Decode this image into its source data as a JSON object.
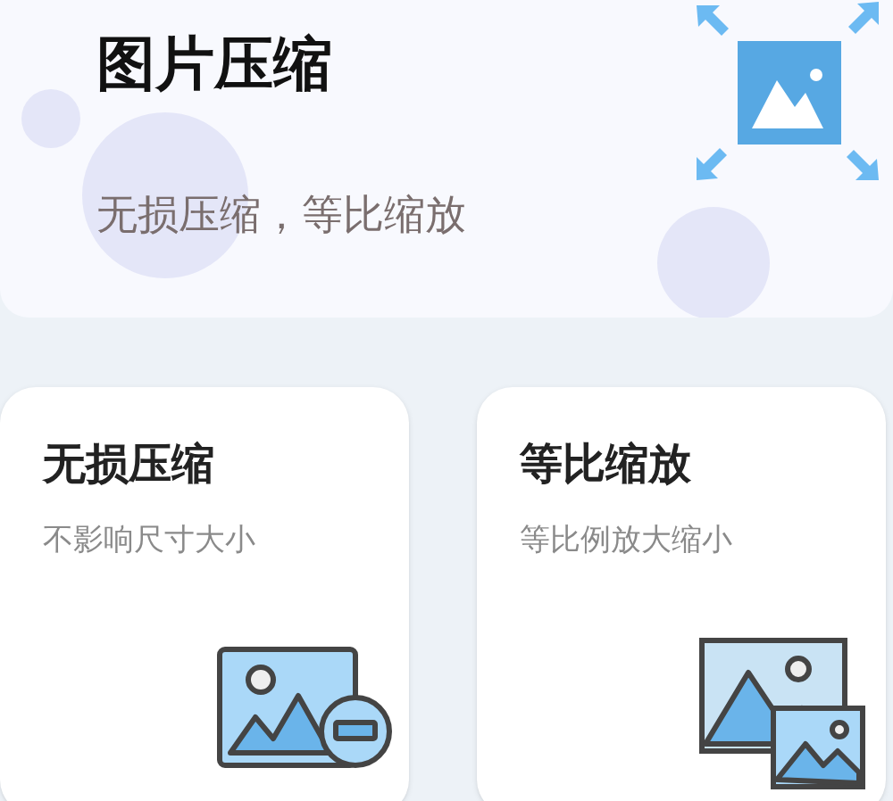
{
  "header": {
    "title": "图片压缩",
    "subtitle": "无损压缩，等比缩放"
  },
  "cards": [
    {
      "kind": "lossless",
      "title": "无损压缩",
      "subtitle": "不影响尺寸大小"
    },
    {
      "kind": "proportional",
      "title": "等比缩放",
      "subtitle": "等比例放大缩小"
    }
  ]
}
